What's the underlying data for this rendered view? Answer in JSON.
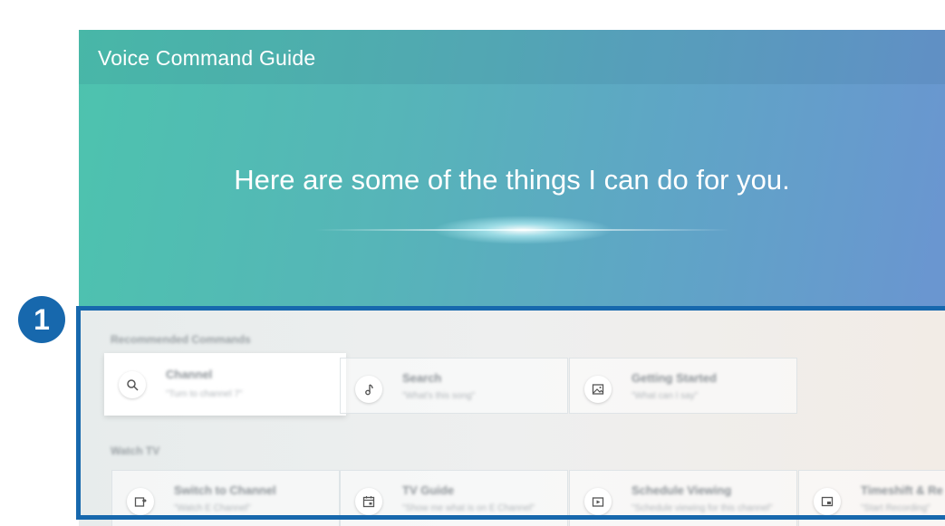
{
  "header": {
    "title": "Voice Command Guide"
  },
  "hero": {
    "headline": "Here are some of the things I can do for you."
  },
  "callout": {
    "number": "1"
  },
  "sections": {
    "recommended": {
      "label": "Recommended Commands",
      "cards": [
        {
          "title": "Channel",
          "subtitle": "\"Turn to channel 7\"",
          "icon": "search-icon"
        },
        {
          "title": "Search",
          "subtitle": "\"What's this song\"",
          "icon": "music-note-icon"
        },
        {
          "title": "Getting Started",
          "subtitle": "\"What can I say\"",
          "icon": "image-icon"
        }
      ]
    },
    "watch_tv": {
      "label": "Watch TV",
      "cards": [
        {
          "title": "Switch to Channel",
          "subtitle": "\"Watch E Channel\"",
          "icon": "channel-switch-icon"
        },
        {
          "title": "TV Guide",
          "subtitle": "\"Show me what is on E Channel\"",
          "icon": "calendar-icon"
        },
        {
          "title": "Schedule Viewing",
          "subtitle": "\"Schedule viewing for this channel\"",
          "icon": "play-screen-icon"
        },
        {
          "title": "Timeshift & Re",
          "subtitle": "\"Start Recording\"",
          "icon": "pip-icon"
        }
      ]
    }
  },
  "colors": {
    "highlight": "#1768ad",
    "gradient_start": "#4dc3ae",
    "gradient_end": "#6c93d2"
  }
}
